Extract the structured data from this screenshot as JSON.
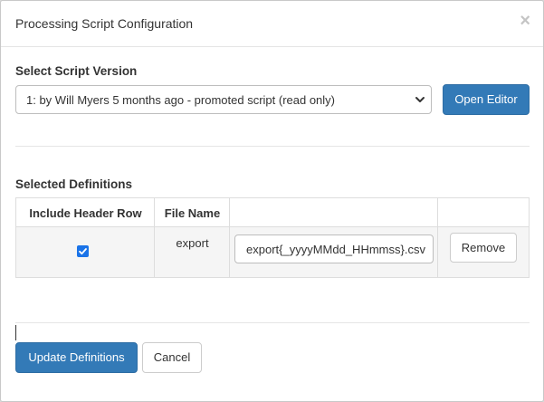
{
  "modal": {
    "title": "Processing Script Configuration",
    "close_symbol": "×"
  },
  "script_version": {
    "label": "Select Script Version",
    "selected": "1: by Will Myers 5 months ago - promoted script (read only)",
    "open_editor_label": "Open Editor"
  },
  "definitions": {
    "label": "Selected Definitions",
    "columns": [
      "Include Header Row",
      "File Name",
      "",
      ""
    ],
    "rows": [
      {
        "include_header_row": true,
        "file_name": "export",
        "file_name_pattern": "export{_yyyyMMdd_HHmmss}.csv",
        "remove_label": "Remove"
      }
    ]
  },
  "footer": {
    "update_label": "Update Definitions",
    "cancel_label": "Cancel"
  },
  "colors": {
    "primary": "#337ab7",
    "checkbox": "#1a73e8"
  }
}
